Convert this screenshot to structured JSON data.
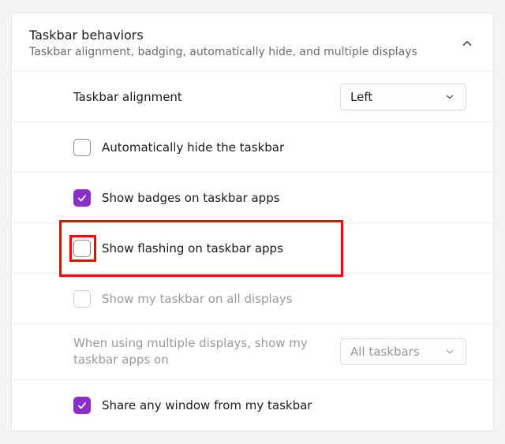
{
  "header": {
    "title": "Taskbar behaviors",
    "subtitle": "Taskbar alignment, badging, automatically hide, and multiple displays"
  },
  "rows": {
    "alignment": {
      "label": "Taskbar alignment",
      "value": "Left"
    },
    "autohide": {
      "label": "Automatically hide the taskbar"
    },
    "badges": {
      "label": "Show badges on taskbar apps"
    },
    "flashing": {
      "label": "Show flashing on taskbar apps"
    },
    "alldisplays": {
      "label": "Show my taskbar on all displays"
    },
    "multidisplay": {
      "label": "When using multiple displays, show my taskbar apps on",
      "value": "All taskbars"
    },
    "shareany": {
      "label": "Share any window from my taskbar"
    }
  }
}
